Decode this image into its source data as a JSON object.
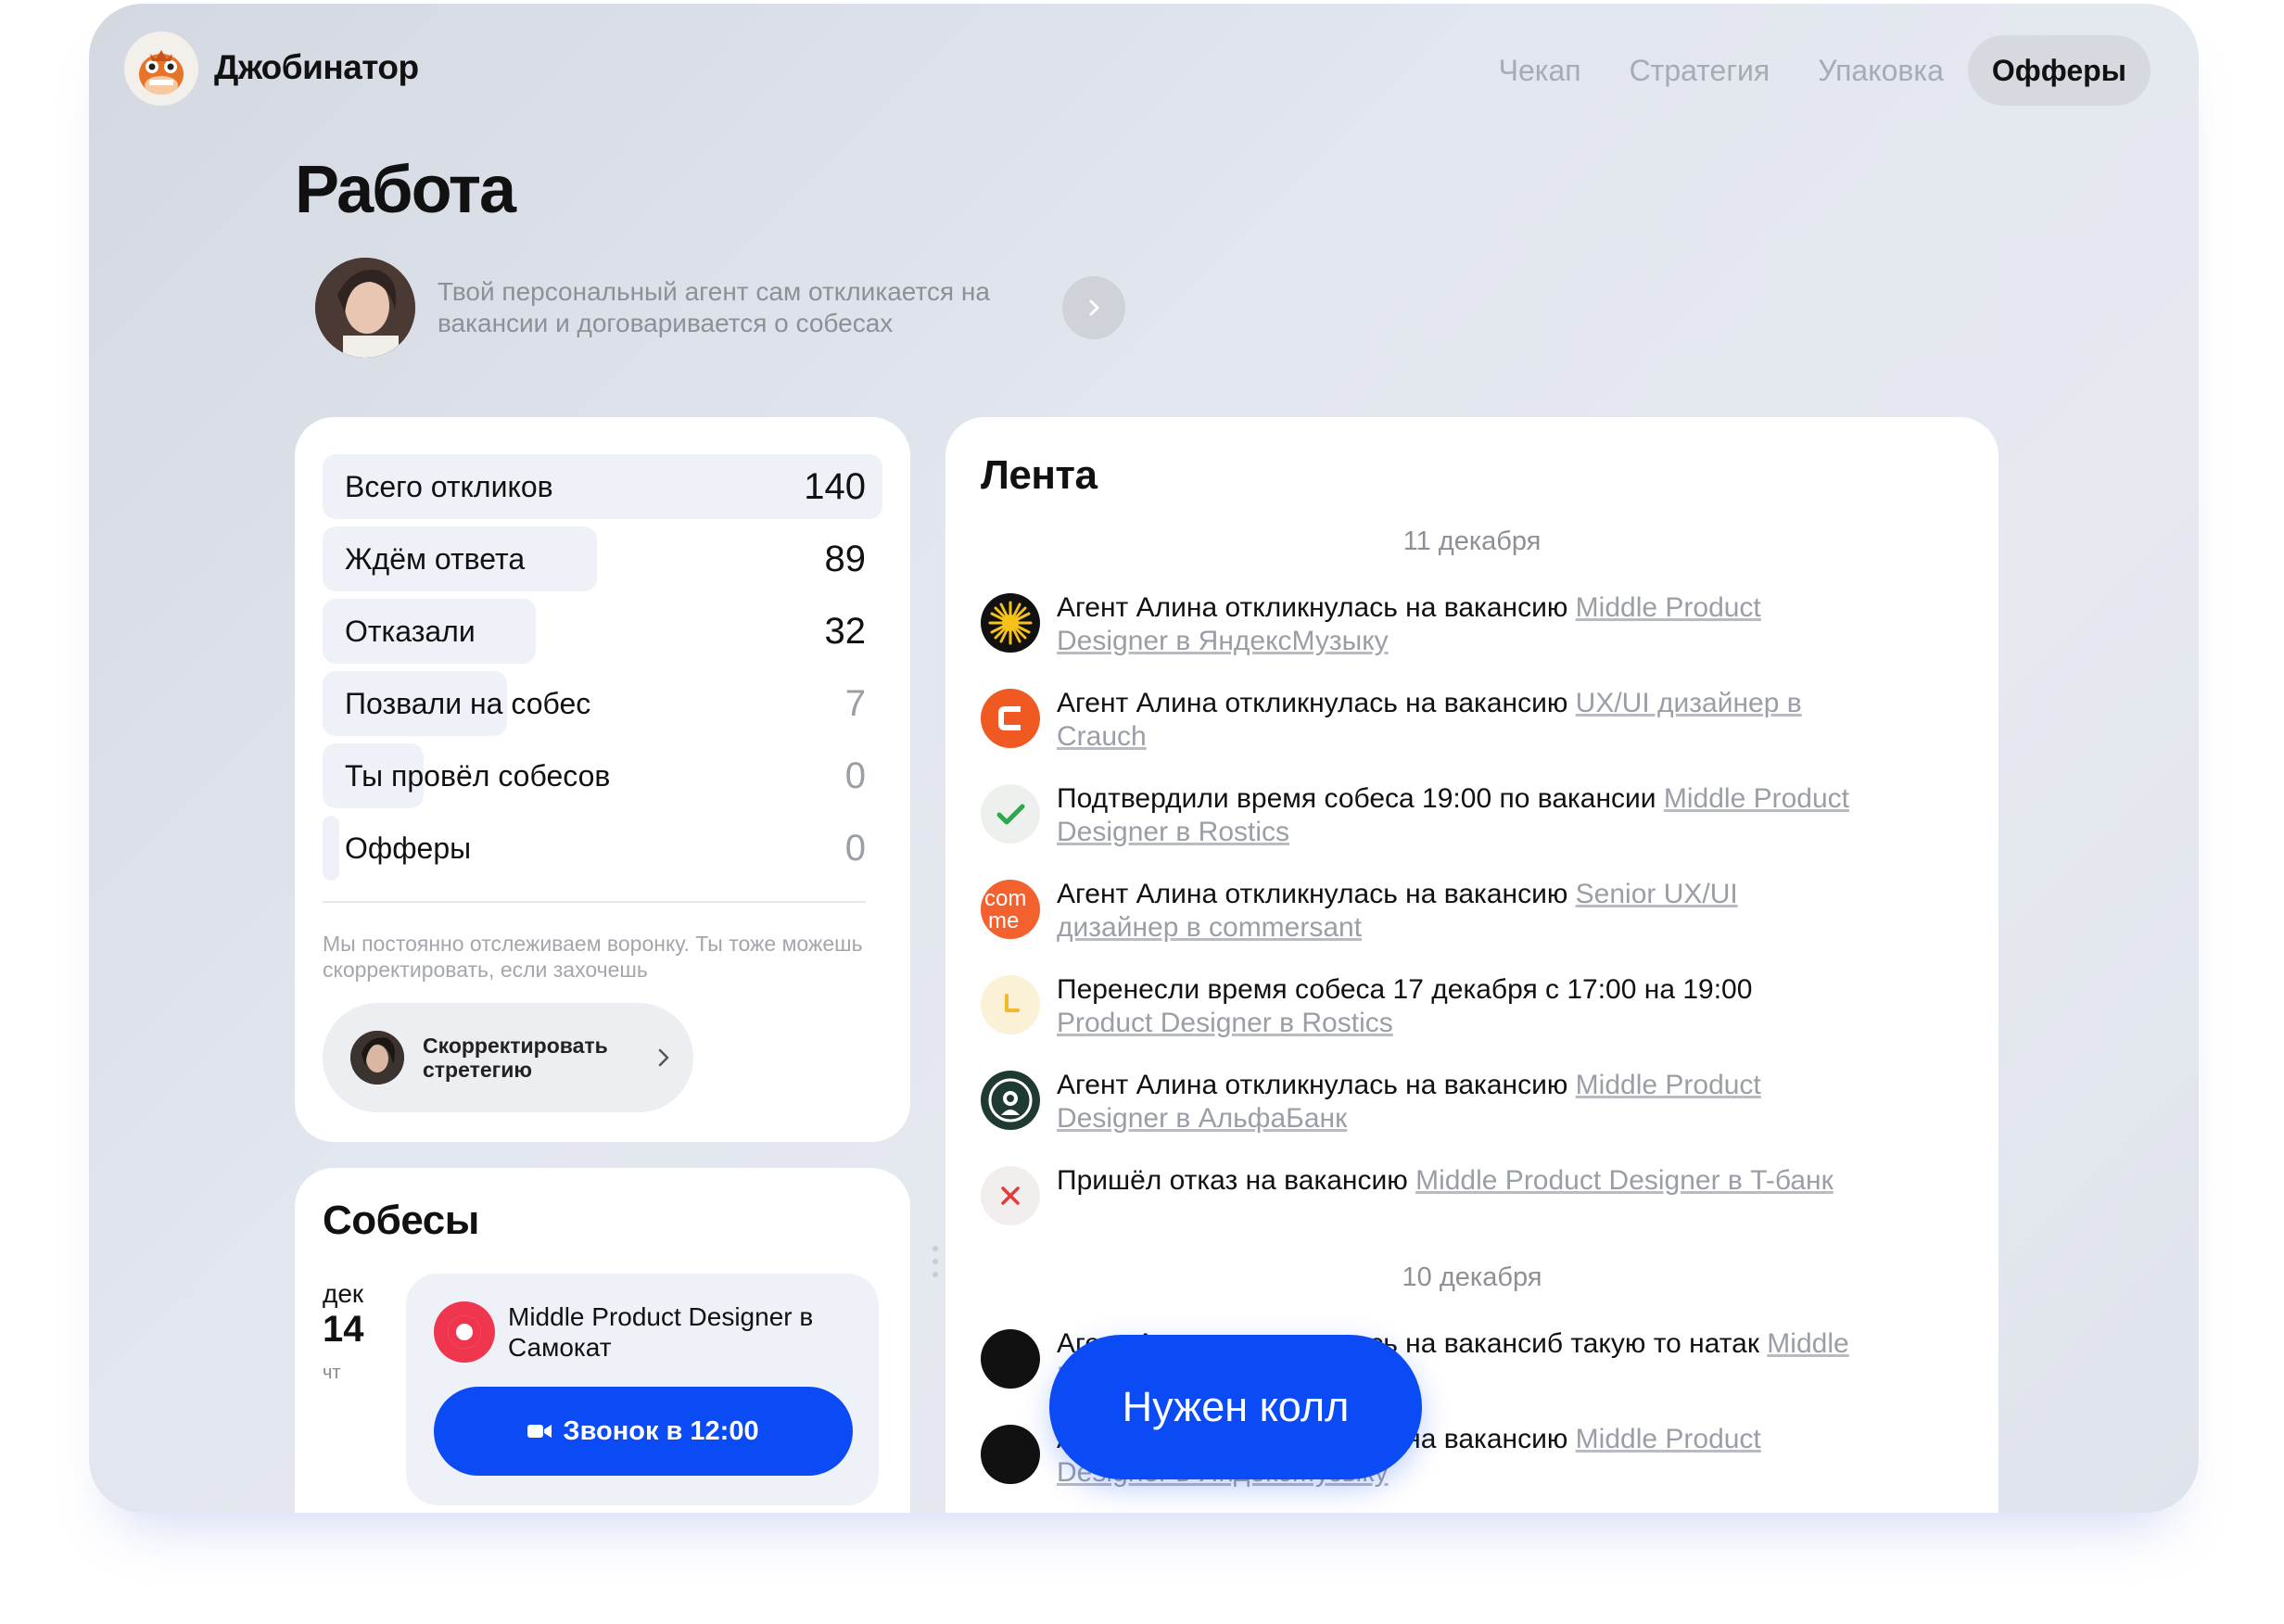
{
  "app": {
    "title": "Джобинатор"
  },
  "nav": [
    {
      "label": "Чекап"
    },
    {
      "label": "Стратегия"
    },
    {
      "label": "Упаковка"
    },
    {
      "label": "Офферы"
    }
  ],
  "page": {
    "title": "Работа"
  },
  "agent": {
    "text": "Твой персональный агент сам  откликается на вакансии и договаривается о собесах"
  },
  "stats": {
    "rows": [
      {
        "label": "Всего откликов",
        "value": "140",
        "fill": 1.0
      },
      {
        "label": "Ждём ответа",
        "value": "89",
        "fill": 0.49
      },
      {
        "label": "Отказали",
        "value": "32",
        "fill": 0.38
      },
      {
        "label": "Позвали на собес",
        "value": "7",
        "fill": 0.33
      },
      {
        "label": "Ты провёл собесов",
        "value": "0",
        "fill": 0.18
      },
      {
        "label": "Офферы",
        "value": "0",
        "fill": 0.03
      }
    ],
    "note": "Мы постоянно отслеживаем воронку. Ты тоже можешь скорректировать, если захочешь",
    "fix_label": "Скорректировать стретегию"
  },
  "interviews": {
    "title": "Собесы",
    "month": "дек",
    "day": "14",
    "weekday": "чт",
    "job": "Middle Product Designer в Самокат",
    "call_label": "Звонок в 12:00"
  },
  "feed": {
    "title": "Лента",
    "date1": "11 декабря",
    "date2": "10 декабря",
    "items": [
      {
        "text": "Агент Алина откликнулась на вакансию ",
        "link": "Middle Product Designer в ЯндексМузыку",
        "icon": "sun-icon"
      },
      {
        "text": "Агент Алина откликнулась на вакансию ",
        "link": "UX/UI дизайнер в Crauch",
        "icon": "crauch-logo-icon"
      },
      {
        "text": "Подтвердили время собеса 19:00 по вакансии  ",
        "link": "Middle Product Designer в Rostics",
        "icon": "check-icon"
      },
      {
        "text": "Агент Алина откликнулась на вакансию ",
        "link": "Senior UX/UI дизайнер в commersant",
        "icon": "commersant-logo-icon"
      },
      {
        "text": "Перенесли время собеса 17 декабря с 17:00 на 19:00 ",
        "link": "Product Designer в Rostics",
        "icon": "clock-icon"
      },
      {
        "text": "Агент Алина откликнулась на вакансию ",
        "link": "Middle Product Designer в АльфаБанк",
        "icon": "starbucks-logo-icon"
      },
      {
        "text": "Пришёл отказ на вакансию  ",
        "link": "Middle Product Designer в T-банк",
        "icon": "cross-icon"
      }
    ],
    "items2": [
      {
        "text": "Агент Алина откликнулась на вакансиб такую то натак ",
        "link": "Middle Product Designer в Rostics"
      },
      {
        "text": "Агент Алина откликнулась на вакансию ",
        "link": "Middle Product Designer в ЯндексМузыку"
      }
    ]
  },
  "cta": {
    "label": "Нужен колл"
  }
}
